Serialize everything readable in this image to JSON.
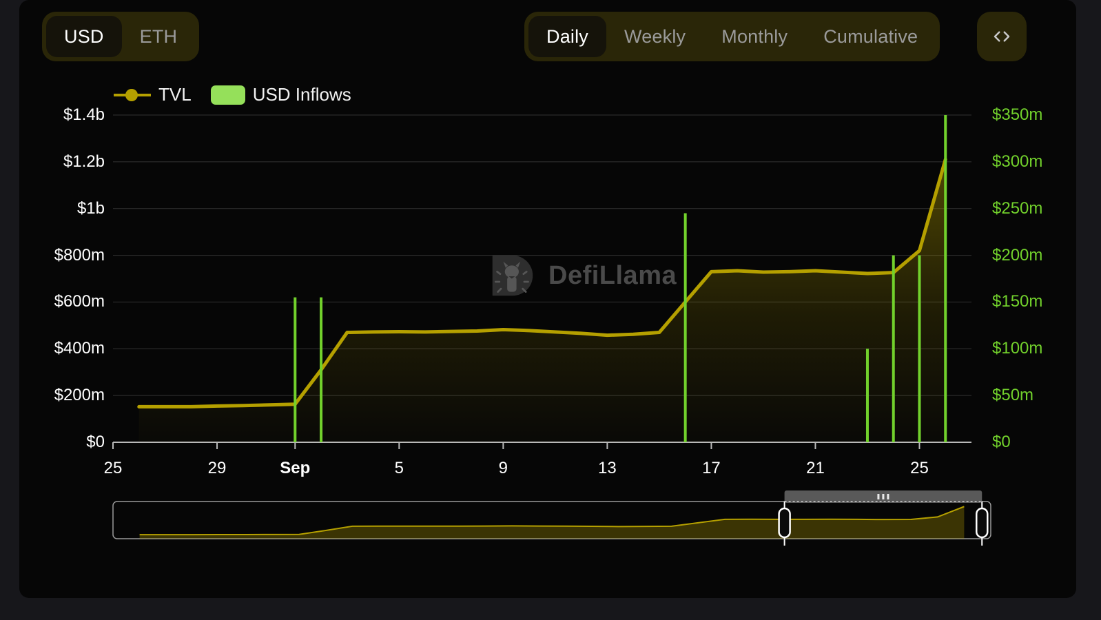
{
  "currency_toggle": {
    "name": "currency-toggle",
    "options": [
      "USD",
      "ETH"
    ],
    "selected": "USD"
  },
  "period_toggle": {
    "name": "period-toggle",
    "options": [
      "Daily",
      "Weekly",
      "Monthly",
      "Cumulative"
    ],
    "selected": "Daily"
  },
  "embed_button": {
    "icon": "code-icon",
    "label": "<>"
  },
  "legend": [
    {
      "label": "TVL",
      "type": "line",
      "color": "#b5a000"
    },
    {
      "label": "USD Inflows",
      "type": "bar",
      "color": "#95e05a"
    }
  ],
  "watermark": {
    "text": "DefiLlama",
    "icon": "defillama-logo-icon"
  },
  "brush": {
    "name": "range-brush",
    "handle_left": "brush-handle-left",
    "handle_right": "brush-handle-right",
    "drag_bar": "brush-drag-bar",
    "selection_start_pct": 76.5,
    "selection_end_pct": 99.0
  },
  "chart_data": {
    "type": "line",
    "title": "",
    "xlabel": "",
    "ylabel": "",
    "grid": true,
    "legend_position": "top-left",
    "x_tick_labels": [
      "25",
      "29",
      "Sep",
      "5",
      "9",
      "13",
      "17",
      "21",
      "25"
    ],
    "x_tick_positions": [
      0,
      4,
      7,
      11,
      15,
      19,
      23,
      27,
      31
    ],
    "x_range": [
      0,
      33
    ],
    "left_axis": {
      "label": "TVL",
      "tick_labels": [
        "$0",
        "$200m",
        "$400m",
        "$600m",
        "$800m",
        "$1b",
        "$1.2b",
        "$1.4b"
      ],
      "tick_values": [
        0,
        200000000,
        400000000,
        600000000,
        800000000,
        1000000000,
        1200000000,
        1400000000
      ],
      "ylim": [
        0,
        1400000000
      ],
      "color": "#ffffff"
    },
    "right_axis": {
      "label": "USD Inflows",
      "tick_labels": [
        "$0",
        "$50m",
        "$100m",
        "$150m",
        "$200m",
        "$250m",
        "$300m",
        "$350m"
      ],
      "tick_values": [
        0,
        50000000,
        100000000,
        150000000,
        200000000,
        250000000,
        300000000,
        350000000
      ],
      "ylim": [
        0,
        350000000
      ],
      "color": "#72d12c"
    },
    "series": [
      {
        "name": "TVL",
        "type": "area-line",
        "axis": "left",
        "color": "#b5a000",
        "x": [
          1,
          2,
          3,
          4,
          5,
          6,
          7,
          8,
          9,
          10,
          11,
          12,
          13,
          14,
          15,
          16,
          17,
          18,
          19,
          20,
          21,
          22,
          23,
          24,
          25,
          26,
          27,
          28,
          29,
          30,
          31,
          32
        ],
        "values": [
          152000000,
          152000000,
          152000000,
          155000000,
          157000000,
          160000000,
          163000000,
          310000000,
          470000000,
          472000000,
          473000000,
          472000000,
          474000000,
          476000000,
          482000000,
          478000000,
          472000000,
          466000000,
          458000000,
          462000000,
          470000000,
          600000000,
          730000000,
          734000000,
          728000000,
          730000000,
          734000000,
          728000000,
          722000000,
          726000000,
          820000000,
          1210000000
        ]
      },
      {
        "name": "USD Inflows",
        "type": "bar",
        "axis": "right",
        "color": "#72d12c",
        "x": [
          7,
          8,
          22,
          29,
          30,
          31,
          32
        ],
        "values": [
          155000000,
          155000000,
          245000000,
          100000000,
          200000000,
          200000000,
          350000000
        ]
      }
    ]
  }
}
